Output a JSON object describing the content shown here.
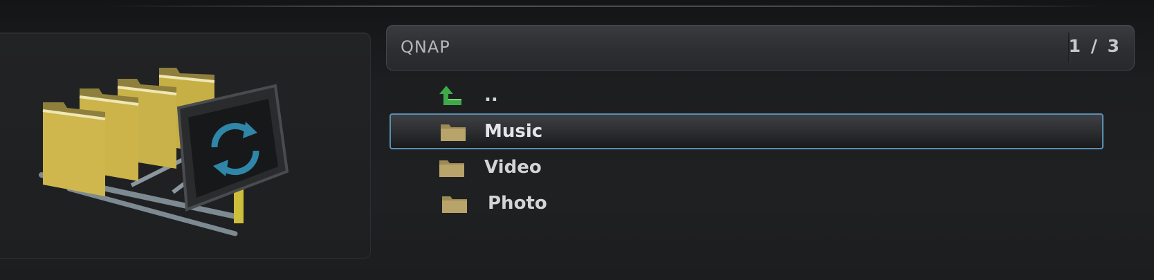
{
  "header": {
    "title": "QNAP",
    "page_indicator": "1 / 3"
  },
  "file_list": {
    "items": [
      {
        "label": "..",
        "icon": "up-arrow-icon",
        "selected": false
      },
      {
        "label": "Music",
        "icon": "folder-icon",
        "selected": true
      },
      {
        "label": "Video",
        "icon": "folder-icon",
        "selected": false
      },
      {
        "label": "Photo",
        "icon": "folder-icon",
        "selected": false
      }
    ]
  },
  "colors": {
    "selection_border": "#5a8fb4",
    "folder": "#b8a46a",
    "up_arrow": "#3fa94a",
    "sync_icon": "#2f86a8"
  }
}
